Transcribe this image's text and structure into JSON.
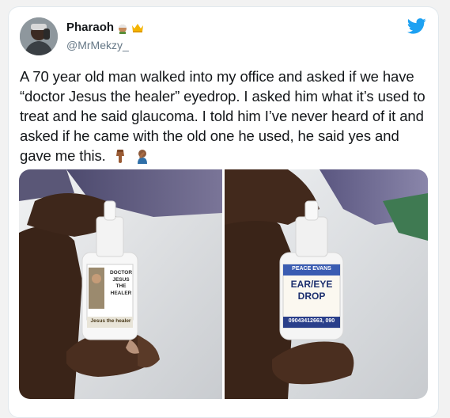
{
  "tweet": {
    "display_name": "Pharaoh",
    "handle": "@MrMekzy_",
    "text": "A 70 year old man walked into my office and asked if we have “doctor Jesus the healer” eyedrop. I asked him what it’s used to treat and he said glaucoma. I told him I’ve never heard of it and asked if he came with the old one he used, he said yes and gave me this.",
    "name_emojis": [
      "man-with-turban-emoji",
      "crown-emoji"
    ],
    "text_emojis": [
      "pointing-down-emoji",
      "facepalm-emoji"
    ]
  },
  "media": {
    "photo1": {
      "label_line1": "DOCTOR",
      "label_line2": "JESUS",
      "label_line3": "THE HEALER",
      "label_bottom": "Jesus the healer"
    },
    "photo2": {
      "label_top": "PEACE EVANS",
      "label_main1": "EAR/EYE",
      "label_main2": "DROP",
      "label_phone": "09043412663, 090"
    }
  },
  "colors": {
    "twitter_blue": "#1da1f2",
    "text": "#14171a",
    "muted": "#657786"
  }
}
